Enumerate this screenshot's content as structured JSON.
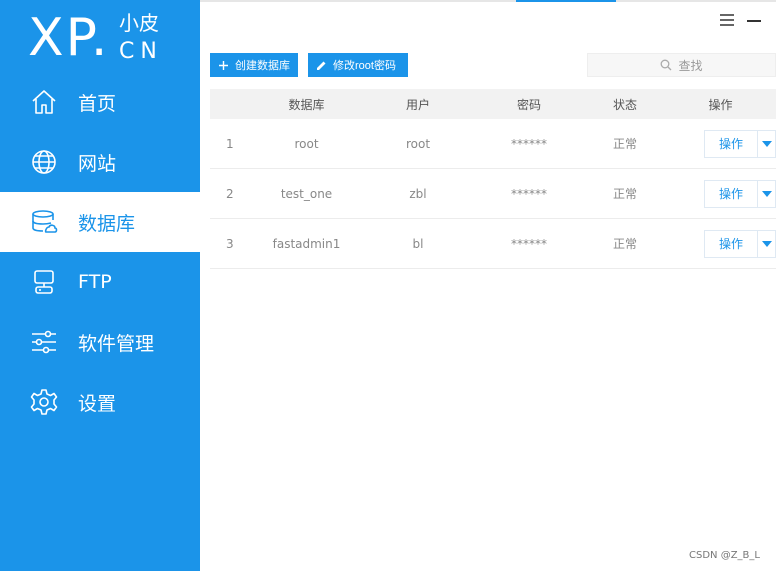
{
  "logo": {
    "xp": "XP.",
    "cn_top": "小皮",
    "cn_bottom": "CN"
  },
  "sidebar": {
    "items": [
      {
        "label": "首页",
        "icon": "home-icon",
        "active": false
      },
      {
        "label": "网站",
        "icon": "globe-icon",
        "active": false
      },
      {
        "label": "数据库",
        "icon": "database-icon",
        "active": true
      },
      {
        "label": "FTP",
        "icon": "ftp-icon",
        "active": false
      },
      {
        "label": "软件管理",
        "icon": "sliders-icon",
        "active": false
      },
      {
        "label": "设置",
        "icon": "gear-icon",
        "active": false
      }
    ]
  },
  "toolbar": {
    "create_label": "创建数据库",
    "modify_label": "修改root密码"
  },
  "search": {
    "placeholder": "查找"
  },
  "table": {
    "headers": [
      "数据库",
      "用户",
      "密码",
      "状态",
      "操作"
    ],
    "rows": [
      {
        "index": "1",
        "db": "root",
        "user": "root",
        "password": "******",
        "status": "正常",
        "action": "操作"
      },
      {
        "index": "2",
        "db": "test_one",
        "user": "zbl",
        "password": "******",
        "status": "正常",
        "action": "操作"
      },
      {
        "index": "3",
        "db": "fastadmin1",
        "user": "bl",
        "password": "******",
        "status": "正常",
        "action": "操作"
      }
    ]
  },
  "watermark": "CSDN @Z_B_L",
  "colors": {
    "accent": "#1b94e9",
    "sidebar_bg": "#1b94e9",
    "table_header_bg": "#f2f2f2"
  }
}
